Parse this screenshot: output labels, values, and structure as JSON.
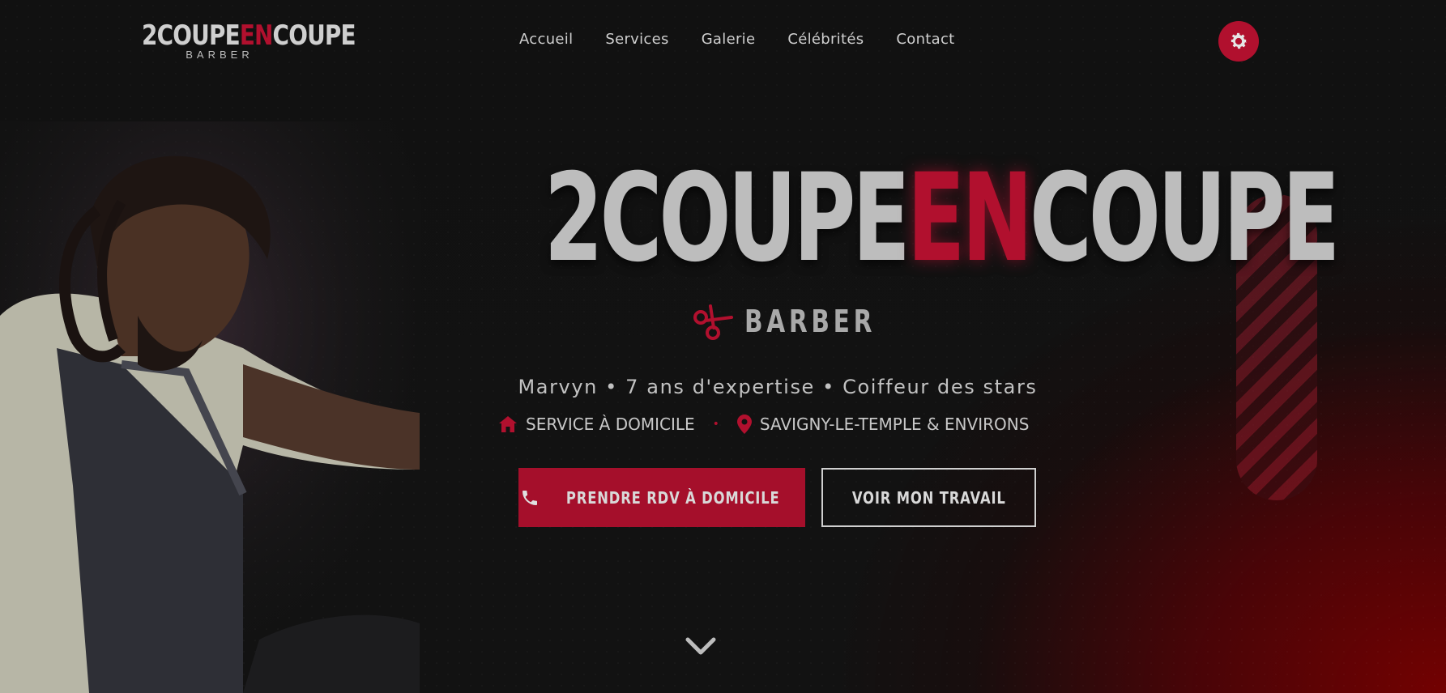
{
  "brand": {
    "logo_main_a": "2COUPE",
    "logo_main_b": "EN",
    "logo_main_c": "COUPE",
    "logo_sub": "BARBER"
  },
  "nav": {
    "items": [
      {
        "label": "Accueil"
      },
      {
        "label": "Services"
      },
      {
        "label": "Galerie"
      },
      {
        "label": "Célébrités"
      },
      {
        "label": "Contact"
      }
    ]
  },
  "hero": {
    "title_a": "2COUPE",
    "title_b": "EN",
    "title_c": "COUPE",
    "barber": "BARBER",
    "tagline": "Marvyn • 7 ans d'expertise • Coiffeur des stars",
    "service_label": "SERVICE À DOMICILE",
    "separator": "•",
    "location_label": "SAVIGNY-LE-TEMPLE & ENVIRONS",
    "cta_primary": "PRENDRE RDV À DOMICILE",
    "cta_secondary": "VOIR MON TRAVAIL"
  },
  "icons": {
    "settings": "gear-icon",
    "barber": "scissors-icon",
    "service": "home-icon",
    "location": "map-pin-icon",
    "cta": "phone-icon",
    "scroll": "chevron-down-icon"
  },
  "colors": {
    "accent": "#b1102e",
    "text": "#c9c9c9",
    "background": "#111111",
    "gradient_red": "#780000"
  }
}
